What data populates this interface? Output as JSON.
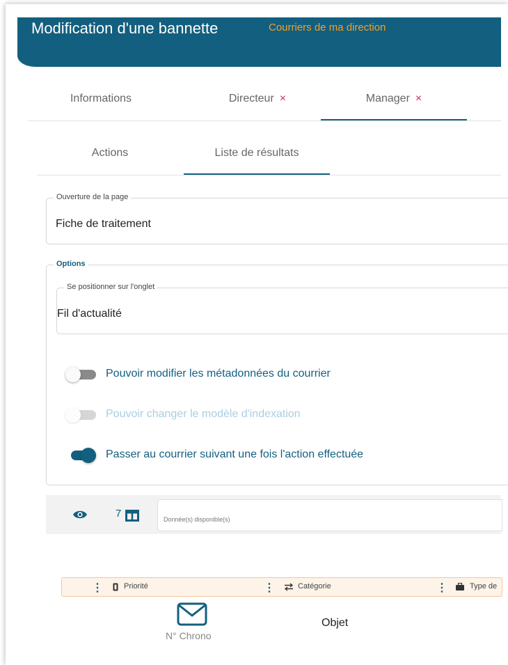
{
  "header": {
    "title": "Modification d'une bannette",
    "subtitle": "Courriers de ma direction"
  },
  "tabs_primary": [
    {
      "label": "Informations"
    },
    {
      "label": "Directeur"
    },
    {
      "label": "Manager"
    }
  ],
  "remove_icon": "×",
  "tabs_secondary": [
    {
      "label": "Actions"
    },
    {
      "label": "Liste de résultats"
    }
  ],
  "page_open": {
    "legend": "Ouverture de la page",
    "value": "Fiche de traitement"
  },
  "options": {
    "legend": "Options",
    "tab_field": {
      "legend": "Se positionner sur l'onglet",
      "value": "Fil d'actualité"
    },
    "toggles": [
      {
        "label": "Pouvoir modifier les métadonnées du courrier",
        "checked": false,
        "disabled": false
      },
      {
        "label": "Pouvoir changer le modèle d'indexation",
        "checked": false,
        "disabled": true
      },
      {
        "label": "Passer au courrier suivant une fois l'action effectuée",
        "checked": true,
        "disabled": false
      }
    ]
  },
  "toolbar": {
    "eye_icon": "eye-icon",
    "columns_count": "7",
    "columns_icon": "columns-icon",
    "search_placeholder": "Donnée(s) disponible(s)"
  },
  "sort_columns": [
    {
      "icon": "priority-icon",
      "label": "Priorité"
    },
    {
      "icon": "swap-arrows-icon",
      "label": "Catégorie"
    },
    {
      "icon": "briefcase-icon",
      "label": "Type de"
    }
  ],
  "result_preview": {
    "envelope_icon": "envelope-icon",
    "chrono_label": "N° Chrono",
    "object_label": "Objet"
  },
  "colors": {
    "primary": "#135f7f",
    "accent": "#f2a02a",
    "danger": "#c0344d"
  }
}
